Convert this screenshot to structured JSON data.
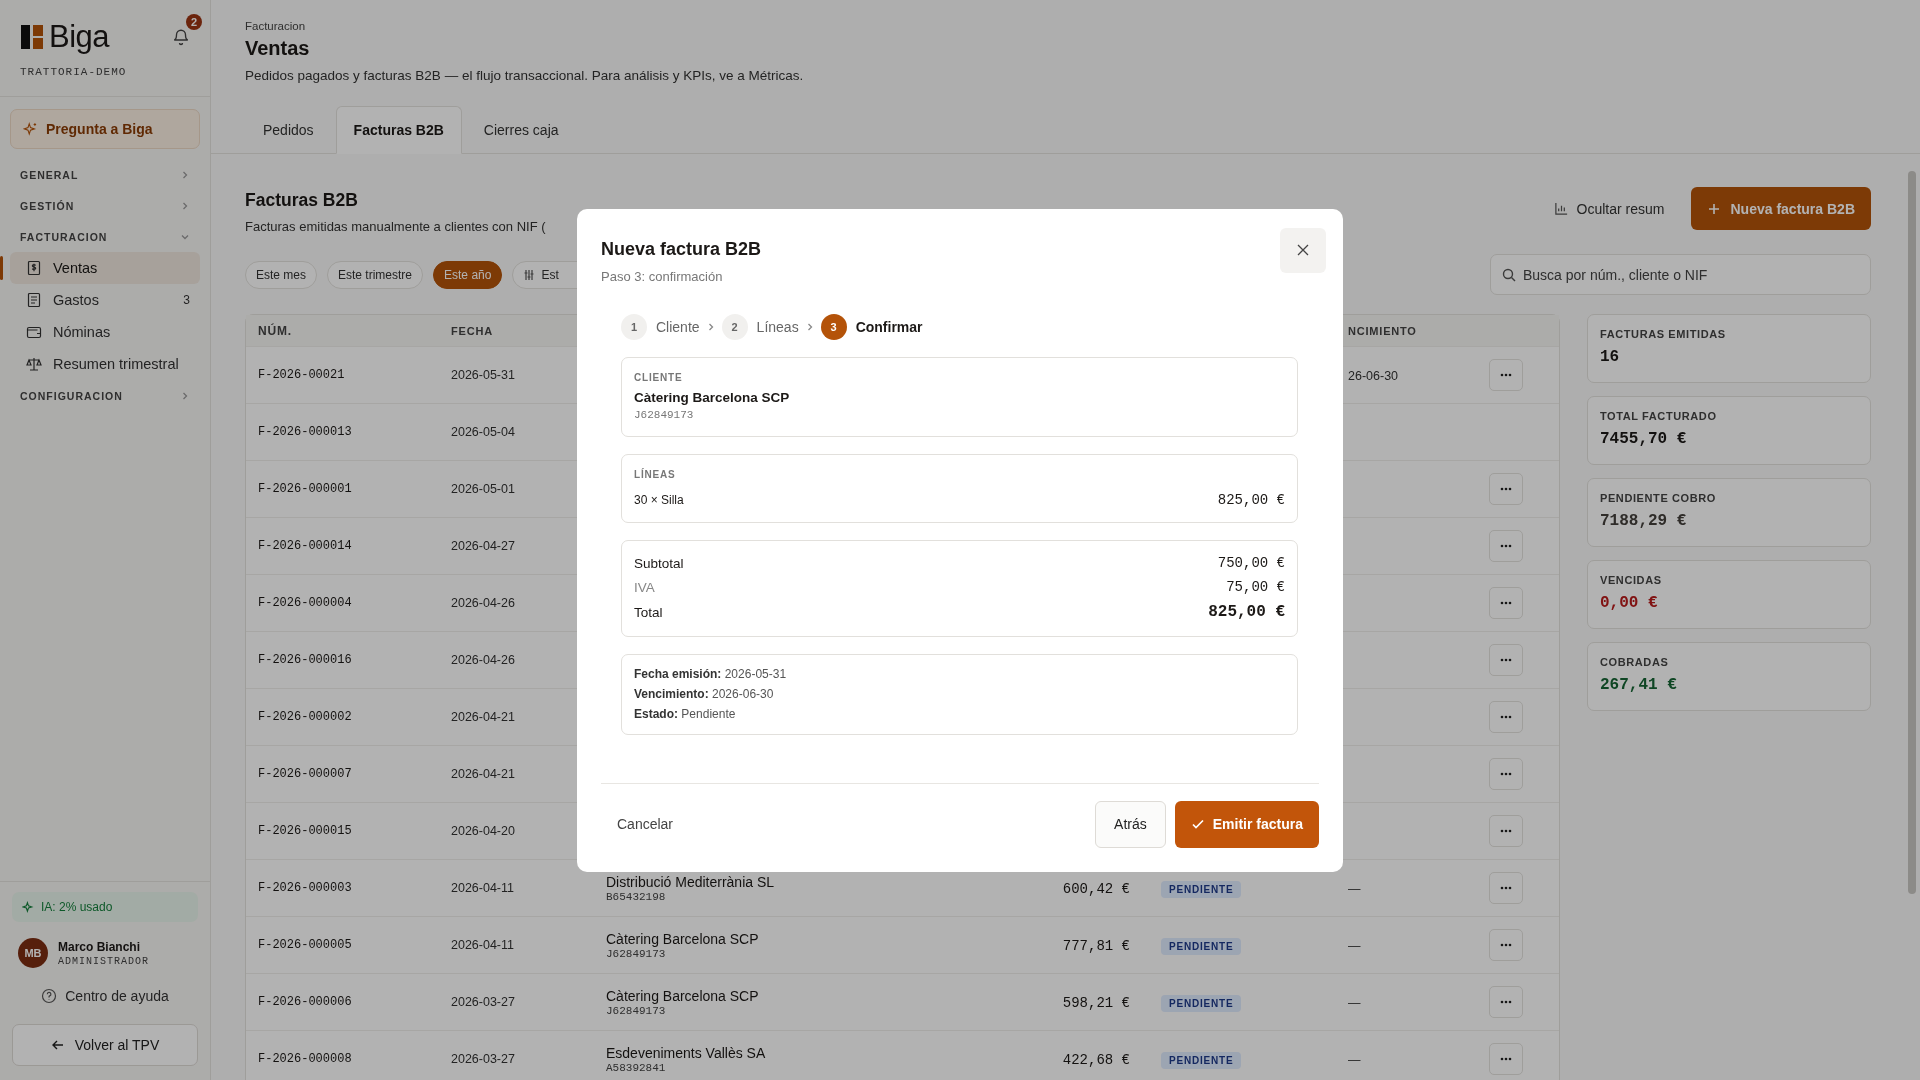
{
  "sidebar": {
    "brand": "Biga",
    "notifications": "2",
    "workspace": "TRATTORIA-DEMO",
    "ask_button": "Pregunta a Biga",
    "sections": [
      {
        "label": "GENERAL",
        "expanded": false
      },
      {
        "label": "GESTIÓN",
        "expanded": false
      },
      {
        "label": "FACTURACION",
        "expanded": true,
        "items": [
          {
            "label": "Ventas",
            "selected": true
          },
          {
            "label": "Gastos",
            "selected": false,
            "count": "3"
          },
          {
            "label": "Nóminas",
            "selected": false
          },
          {
            "label": "Resumen trimestral",
            "selected": false
          }
        ]
      },
      {
        "label": "CONFIGURACION",
        "expanded": false
      }
    ],
    "ai_usage": "IA: 2% usado",
    "user": {
      "initials": "MB",
      "name": "Marco Bianchi",
      "role": "ADMINISTRADOR"
    },
    "help": "Centro de ayuda",
    "back_button": "Volver al TPV"
  },
  "header": {
    "breadcrumb": "Facturacion",
    "title": "Ventas",
    "subtitle": "Pedidos pagados y facturas B2B — el flujo transaccional. Para análisis y KPIs, ve a Métricas."
  },
  "tabs": [
    {
      "label": "Pedidos",
      "selected": false
    },
    {
      "label": "Facturas B2B",
      "selected": true
    },
    {
      "label": "Cierres caja",
      "selected": false
    }
  ],
  "section": {
    "title": "Facturas B2B",
    "subtitle": "Facturas emitidas manualmente a clientes con NIF (",
    "toggle_summary": "Ocultar resum",
    "new_button": "Nueva factura B2B",
    "search": {
      "placeholder": "Busca por núm., cliente o NIF"
    }
  },
  "filters": [
    {
      "label": "Este mes",
      "selected": false,
      "kind": "period"
    },
    {
      "label": "Este trimestre",
      "selected": false,
      "kind": "period"
    },
    {
      "label": "Este año",
      "selected": true,
      "kind": "period"
    },
    {
      "label": "Est",
      "selected": false,
      "kind": "advanced"
    }
  ],
  "table": {
    "header": {
      "num": "NÚM.",
      "fecha": "FECHA",
      "vencimiento": "NCIMIENTO"
    },
    "rows": [
      {
        "num": "F-2026-00021",
        "fecha": "2026-05-31",
        "vencimiento": "26-06-30",
        "menu": true
      },
      {
        "num": "F-2026-000013",
        "fecha": "2026-05-04",
        "menu": false
      },
      {
        "num": "F-2026-000001",
        "fecha": "2026-05-01",
        "menu": true
      },
      {
        "num": "F-2026-000014",
        "fecha": "2026-04-27",
        "menu": true
      },
      {
        "num": "F-2026-000004",
        "fecha": "2026-04-26",
        "menu": true
      },
      {
        "num": "F-2026-000016",
        "fecha": "2026-04-26",
        "menu": true
      },
      {
        "num": "F-2026-000002",
        "fecha": "2026-04-21",
        "menu": true
      },
      {
        "num": "F-2026-000007",
        "fecha": "2026-04-21",
        "menu": true
      },
      {
        "num": "F-2026-000015",
        "fecha": "2026-04-20",
        "menu": true
      },
      {
        "num": "F-2026-000003",
        "fecha": "2026-04-11",
        "cliente": "Distribució Mediterrània SL",
        "nif": "B65432198",
        "importe": "600,42 €",
        "estado": "PENDIENTE",
        "vencimiento": "—",
        "menu": true
      },
      {
        "num": "F-2026-000005",
        "fecha": "2026-04-11",
        "cliente": "Càtering Barcelona SCP",
        "nif": "J62849173",
        "importe": "777,81 €",
        "estado": "PENDIENTE",
        "vencimiento": "—",
        "menu": true
      },
      {
        "num": "F-2026-000006",
        "fecha": "2026-03-27",
        "cliente": "Càtering Barcelona SCP",
        "nif": "J62849173",
        "importe": "598,21 €",
        "estado": "PENDIENTE",
        "vencimiento": "—",
        "menu": true
      },
      {
        "num": "F-2026-000008",
        "fecha": "2026-03-27",
        "cliente": "Esdeveniments Vallès SA",
        "nif": "A58392841",
        "importe": "422,68 €",
        "estado": "PENDIENTE",
        "vencimiento": "—",
        "menu": true
      }
    ]
  },
  "summary": [
    {
      "label": "FACTURAS EMITIDAS",
      "value": "16",
      "kind": "neutral"
    },
    {
      "label": "TOTAL FACTURADO",
      "value": "7455,70 €",
      "kind": "neutral"
    },
    {
      "label": "PENDIENTE COBRO",
      "value": "7188,29 €",
      "kind": "muted"
    },
    {
      "label": "VENCIDAS",
      "value": "0,00 €",
      "kind": "negative"
    },
    {
      "label": "COBRADAS",
      "value": "267,41 €",
      "kind": "positive"
    }
  ],
  "modal": {
    "title": "Nueva factura B2B",
    "subtitle": "Paso 3: confirmación",
    "steps": [
      {
        "number": "1",
        "label": "Cliente",
        "selected": false
      },
      {
        "number": "2",
        "label": "Líneas",
        "selected": false
      },
      {
        "number": "3",
        "label": "Confirmar",
        "selected": true
      }
    ],
    "client": {
      "heading": "CLIENTE",
      "name": "Càtering Barcelona SCP",
      "nif": "J62849173"
    },
    "lines": {
      "heading": "LÍNEAS",
      "items": [
        {
          "description": "30 × Silla",
          "amount": "825,00 €"
        }
      ]
    },
    "totals": [
      {
        "label": "Subtotal",
        "value": "750,00 €",
        "kind": "normal"
      },
      {
        "label": "IVA",
        "value": "75,00 €",
        "kind": "tax"
      },
      {
        "label": "Total",
        "value": "825,00 €",
        "kind": "grand"
      }
    ],
    "details": [
      "**Fecha emisión:** 2026-05-31",
      "**Vencimiento:** 2026-06-30",
      "**Estado:** Pendiente"
    ],
    "cancel": "Cancelar",
    "back": "Atrás",
    "submit": "Emitir factura"
  }
}
